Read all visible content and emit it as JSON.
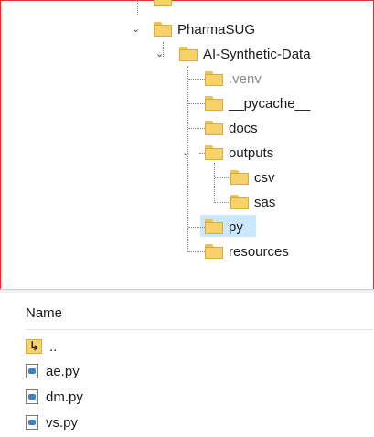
{
  "tree": {
    "items": [
      {
        "label": "PharmaSUG",
        "expanded": true
      },
      {
        "label": "AI-Synthetic-Data",
        "expanded": true
      },
      {
        "label": ".venv",
        "dimmed": true
      },
      {
        "label": "__pycache__"
      },
      {
        "label": "docs"
      },
      {
        "label": "outputs",
        "expanded": true
      },
      {
        "label": "csv"
      },
      {
        "label": "sas"
      },
      {
        "label": "py",
        "selected": true
      },
      {
        "label": "resources"
      }
    ]
  },
  "file_list": {
    "column_name": "Name",
    "items": [
      {
        "label": "..",
        "icon": "folder-up-icon"
      },
      {
        "label": "ae.py",
        "icon": "python-file-icon"
      },
      {
        "label": "dm.py",
        "icon": "python-file-icon"
      },
      {
        "label": "vs.py",
        "icon": "python-file-icon"
      }
    ]
  },
  "colors": {
    "selection": "#cce8ff",
    "folder": "#f7d26b",
    "frame_border": "#e03030"
  }
}
